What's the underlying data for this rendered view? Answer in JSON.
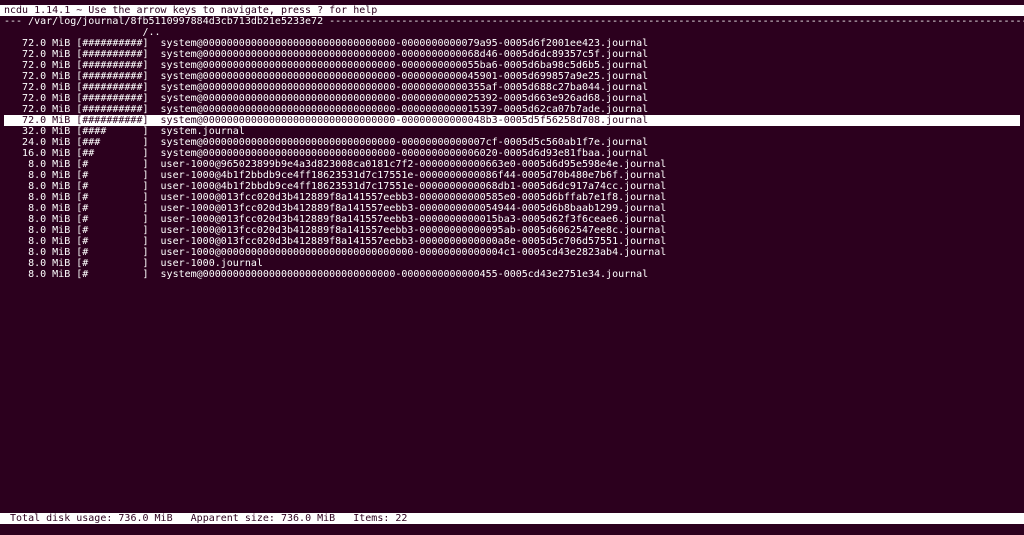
{
  "header": "ncdu 1.14.1 ~ Use the arrow keys to navigate, press ? for help",
  "path_prefix": "---",
  "path": "/var/log/journal/8fb5110997884d3cb713db21e5233e72",
  "path_dashes": "-------------------------------------------------------------------------------------------------------------------------------------------------------",
  "up_dir": "                       /..",
  "rows": [
    {
      "size": "   72.0 MiB",
      "bar": "[##########]",
      "name": "system@00000000000000000000000000000000-0000000000079a95-0005d6f2001ee423.journal"
    },
    {
      "size": "   72.0 MiB",
      "bar": "[##########]",
      "name": "system@00000000000000000000000000000000-0000000000068d46-0005d6dc89357c5f.journal"
    },
    {
      "size": "   72.0 MiB",
      "bar": "[##########]",
      "name": "system@00000000000000000000000000000000-0000000000055ba6-0005d6ba98c5d6b5.journal"
    },
    {
      "size": "   72.0 MiB",
      "bar": "[##########]",
      "name": "system@00000000000000000000000000000000-0000000000045901-0005d699857a9e25.journal"
    },
    {
      "size": "   72.0 MiB",
      "bar": "[##########]",
      "name": "system@00000000000000000000000000000000-00000000000355af-0005d688c27ba044.journal"
    },
    {
      "size": "   72.0 MiB",
      "bar": "[##########]",
      "name": "system@00000000000000000000000000000000-0000000000025392-0005d663e926ad68.journal"
    },
    {
      "size": "   72.0 MiB",
      "bar": "[##########]",
      "name": "system@00000000000000000000000000000000-0000000000015397-0005d62ca07b7ade.journal"
    },
    {
      "size": "   72.0 MiB",
      "bar": "[##########]",
      "name": "system@00000000000000000000000000000000-00000000000048b3-0005d5f56258d708.journal"
    },
    {
      "size": "   32.0 MiB",
      "bar": "[####      ]",
      "name": "system.journal"
    },
    {
      "size": "   24.0 MiB",
      "bar": "[###       ]",
      "name": "system@00000000000000000000000000000000-00000000000007cf-0005d5c560ab1f7e.journal"
    },
    {
      "size": "   16.0 MiB",
      "bar": "[##        ]",
      "name": "system@00000000000000000000000000000000-0000000000006020-0005d6d93e81fbaa.journal"
    },
    {
      "size": "    8.0 MiB",
      "bar": "[#         ]",
      "name": "user-1000@965023899b9e4a3d823008ca0181c7f2-00000000000663e0-0005d6d95e598e4e.journal"
    },
    {
      "size": "    8.0 MiB",
      "bar": "[#         ]",
      "name": "user-1000@4b1f2bbdb9ce4ff18623531d7c17551e-0000000000086f44-0005d70b480e7b6f.journal"
    },
    {
      "size": "    8.0 MiB",
      "bar": "[#         ]",
      "name": "user-1000@4b1f2bbdb9ce4ff18623531d7c17551e-0000000000068db1-0005d6dc917a74cc.journal"
    },
    {
      "size": "    8.0 MiB",
      "bar": "[#         ]",
      "name": "user-1000@013fcc020d3b412889f8a141557eebb3-00000000000585e0-0005d6bffab7e1f8.journal"
    },
    {
      "size": "    8.0 MiB",
      "bar": "[#         ]",
      "name": "user-1000@013fcc020d3b412889f8a141557eebb3-0000000000054944-0005d6b8baab1299.journal"
    },
    {
      "size": "    8.0 MiB",
      "bar": "[#         ]",
      "name": "user-1000@013fcc020d3b412889f8a141557eebb3-0000000000015ba3-0005d62f3f6ceae6.journal"
    },
    {
      "size": "    8.0 MiB",
      "bar": "[#         ]",
      "name": "user-1000@013fcc020d3b412889f8a141557eebb3-00000000000095ab-0005d6062547ee8c.journal"
    },
    {
      "size": "    8.0 MiB",
      "bar": "[#         ]",
      "name": "user-1000@013fcc020d3b412889f8a141557eebb3-0000000000000a8e-0005d5c706d57551.journal"
    },
    {
      "size": "    8.0 MiB",
      "bar": "[#         ]",
      "name": "user-1000@00000000000000000000000000000000-00000000000004c1-0005cd43e2823ab4.journal"
    },
    {
      "size": "    8.0 MiB",
      "bar": "[#         ]",
      "name": "user-1000.journal"
    },
    {
      "size": "    8.0 MiB",
      "bar": "[#         ]",
      "name": "system@00000000000000000000000000000000-0000000000000455-0005cd43e2751e34.journal"
    }
  ],
  "highlighted_index": 7,
  "footer": {
    "prefix": " Total disk usage:",
    "total_disk": "736.0 MiB",
    "apparent_label": "Apparent size:",
    "apparent": "736.0 MiB",
    "items_label": "Items:",
    "items": "22"
  }
}
